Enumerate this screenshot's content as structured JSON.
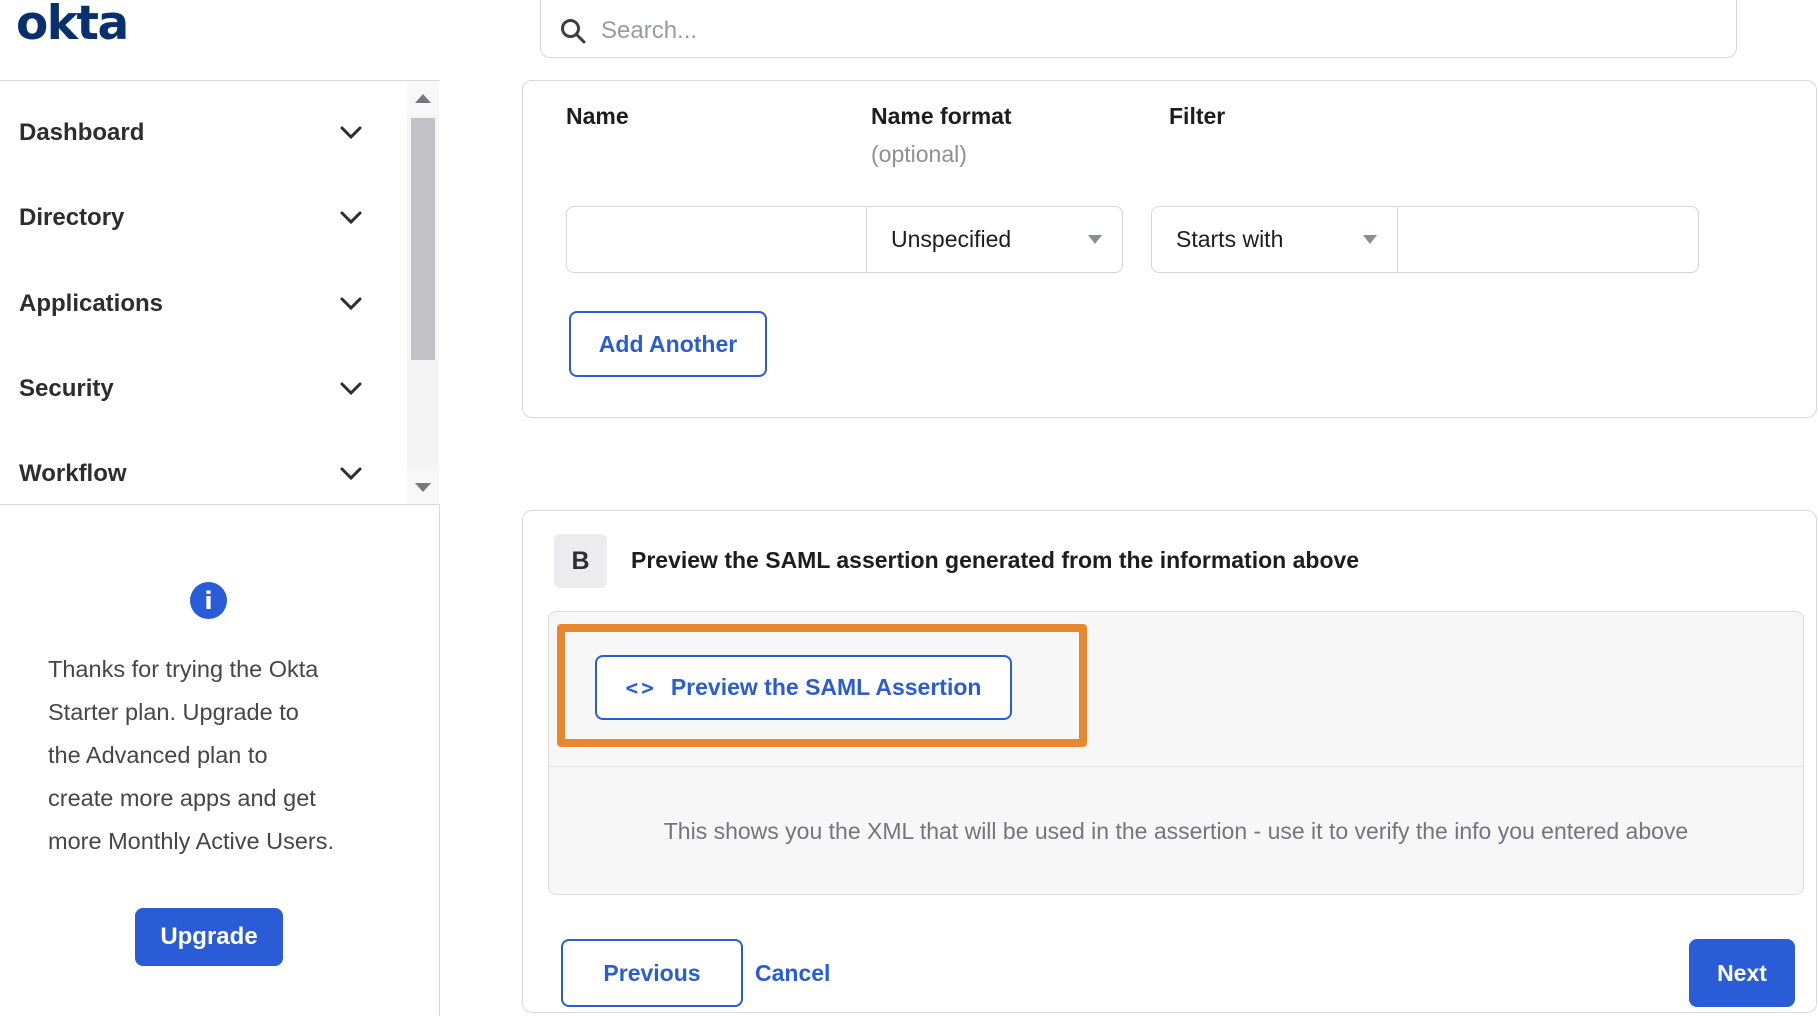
{
  "brand": {
    "logo_text": "okta",
    "logo_color": "#09306e"
  },
  "header": {
    "search_placeholder": "Search..."
  },
  "sidebar": {
    "items": [
      {
        "label": "Dashboard"
      },
      {
        "label": "Directory"
      },
      {
        "label": "Applications"
      },
      {
        "label": "Security"
      },
      {
        "label": "Workflow"
      }
    ],
    "upsell": {
      "message_lines": [
        "Thanks for trying the Okta",
        "Starter plan. Upgrade to",
        "the Advanced plan to",
        "create more apps and get",
        "more Monthly Active Users."
      ],
      "upgrade_label": "Upgrade"
    }
  },
  "main": {
    "attribute_form": {
      "columns": [
        {
          "label": "Name",
          "hint": ""
        },
        {
          "label": "Name format",
          "hint": "(optional)"
        },
        {
          "label": "Filter",
          "hint": ""
        }
      ],
      "name_value": "",
      "name_format_selected": "Unspecified",
      "filter_type_selected": "Starts with",
      "filter_value": "",
      "add_another_label": "Add Another"
    },
    "preview_section": {
      "step_badge": "B",
      "title": "Preview the SAML assertion generated from the information above",
      "preview_button_icon_glyph": "<>",
      "preview_button_label": "Preview the SAML Assertion",
      "description": "This shows you the XML that will be used in the assertion - use it to verify the info you entered above"
    },
    "footer": {
      "previous_label": "Previous",
      "cancel_label": "Cancel",
      "next_label": "Next"
    }
  },
  "icons": {
    "search": "magnifying-glass",
    "menu_expand": "chevron-down",
    "scroll_up": "triangle-up",
    "scroll_down": "triangle-down",
    "upsell": "info-circle",
    "dropdown": "caret-down",
    "preview": "code-brackets"
  },
  "colors": {
    "accent_blue": "#2a5cd7",
    "logo_navy": "#09306e",
    "annotation_orange": "#e8872d",
    "text_dark": "#1d1d21",
    "text_grey": "#75757c",
    "border_grey": "#d8d8dc"
  }
}
